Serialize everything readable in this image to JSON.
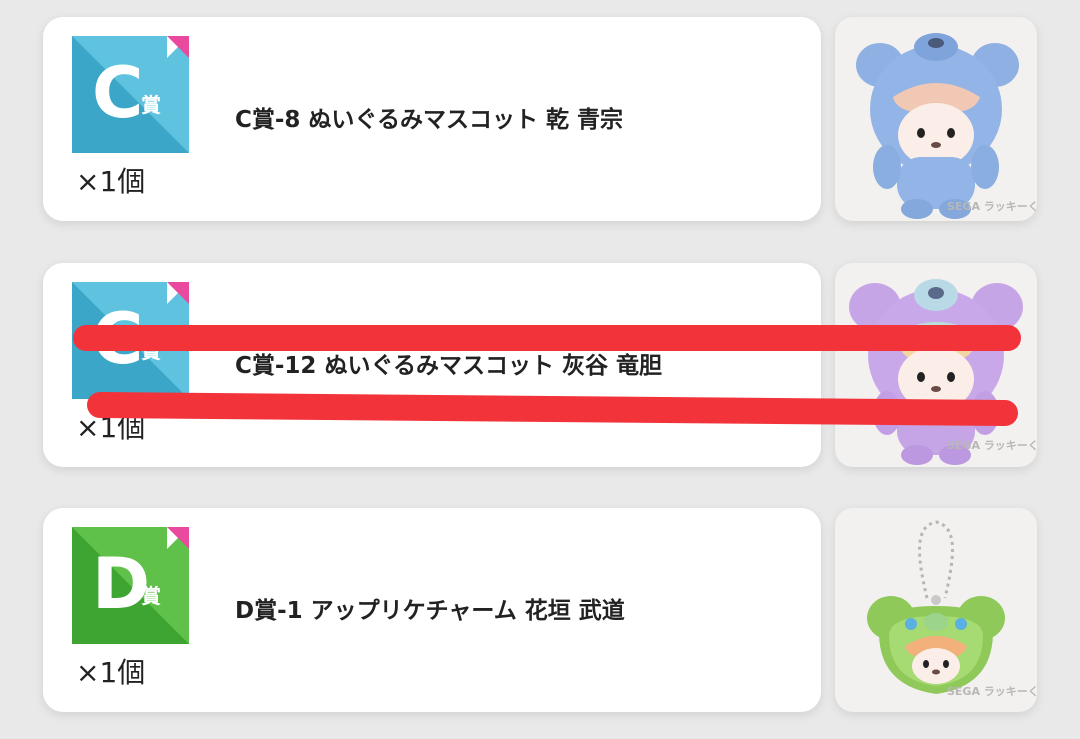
{
  "prizes": [
    {
      "letter": "C",
      "suffix": "賞",
      "title": "C賞-8 ぬいぐるみマスコット 乾 青宗",
      "quantity": "×1個",
      "badge_color": "#5fc3e0",
      "badge_shade": "#3ba6c8",
      "image_icon": "blue-bear-plush-mascot-icon",
      "watermark": "SEGA ラッキーくじ"
    },
    {
      "letter": "C",
      "suffix": "賞",
      "title": "C賞-12 ぬいぐるみマスコット 灰谷 竜胆",
      "quantity": "×1個",
      "badge_color": "#5fc3e0",
      "badge_shade": "#3ba6c8",
      "image_icon": "purple-bear-plush-mascot-icon",
      "watermark": "SEGA ラッキーくじ",
      "struck_out": true,
      "strike_color": "#f2333a"
    },
    {
      "letter": "D",
      "suffix": "賞",
      "title": "D賞-1 アップリケチャーム 花垣 武道",
      "quantity": "×1個",
      "badge_color": "#5fc04a",
      "badge_shade": "#3ea532",
      "image_icon": "green-bear-applique-charm-icon",
      "watermark": "SEGA ラッキーくじ"
    }
  ]
}
